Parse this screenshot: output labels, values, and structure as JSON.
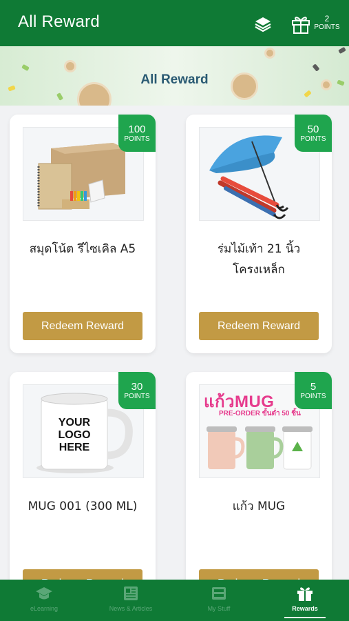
{
  "header": {
    "title": "All Reward",
    "points_value": "2",
    "points_label": "POINTS",
    "icons": [
      "layers-icon",
      "gift-icon"
    ]
  },
  "banner": {
    "title": "All Reward"
  },
  "rewards": [
    {
      "name": "สมุดโน้ต รีไซเคิล A5",
      "points": "100",
      "points_label": "POINTS",
      "button": "Redeem Reward"
    },
    {
      "name": "ร่มไม้เท้า 21 นิ้ว โครงเหล็ก",
      "points": "50",
      "points_label": "POINTS",
      "button": "Redeem Reward"
    },
    {
      "name": "MUG 001 (300 ML)",
      "points": "30",
      "points_label": "POINTS",
      "button": "Redeem Reward",
      "mug_text": "YOUR LOGO HERE"
    },
    {
      "name": "แก้ว MUG",
      "points": "5",
      "points_label": "POINTS",
      "button": "Redeem Reward",
      "promo_title": "แก้วMUG",
      "promo_sub": "PRE-ORDER ขั้นต่ำ 50 ชิ้น"
    }
  ],
  "bottom_nav": [
    {
      "label": "eLearning",
      "icon": "graduation-cap-icon"
    },
    {
      "label": "News & Articles",
      "icon": "newspaper-icon"
    },
    {
      "label": "My Stuff",
      "icon": "stuff-icon"
    },
    {
      "label": "Rewards",
      "icon": "gift-icon",
      "active": true
    }
  ],
  "colors": {
    "primary": "#0f7a35",
    "badge": "#1fa54e",
    "button": "#c29a44",
    "banner_title": "#2a5a73"
  }
}
